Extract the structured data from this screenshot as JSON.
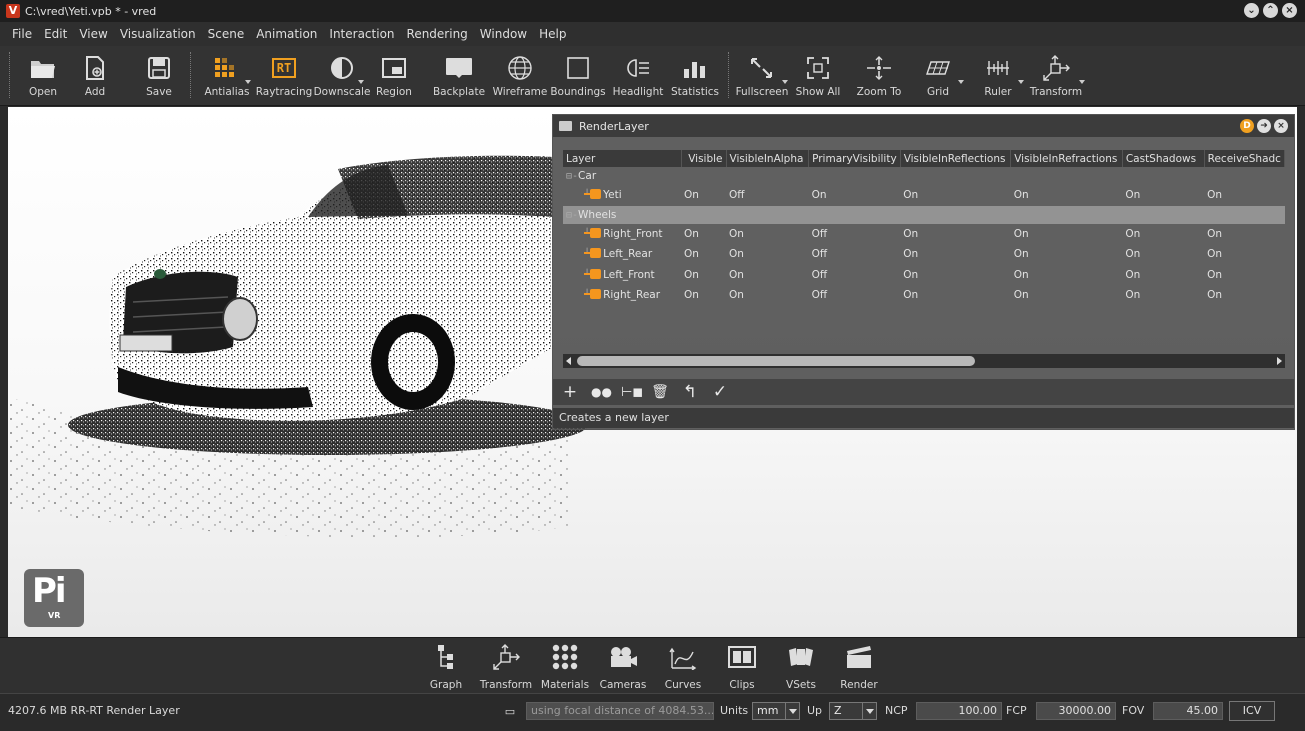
{
  "window": {
    "title": "C:\\vred\\Yeti.vpb * - vred",
    "app_logo": "V"
  },
  "menu": [
    "File",
    "Edit",
    "View",
    "Visualization",
    "Scene",
    "Animation",
    "Interaction",
    "Rendering",
    "Window",
    "Help"
  ],
  "toolbar": {
    "open": "Open",
    "add": "Add",
    "save": "Save",
    "antialias": "Antialias",
    "raytracing": "Raytracing",
    "raytracing_icon_text": "RT",
    "downscale": "Downscale",
    "region": "Region",
    "backplate": "Backplate",
    "wireframe": "Wireframe",
    "boundings": "Boundings",
    "headlight": "Headlight",
    "statistics": "Statistics",
    "fullscreen": "Fullscreen",
    "show_all": "Show All",
    "zoom_to": "Zoom To",
    "grid": "Grid",
    "ruler": "Ruler",
    "transform": "Transform"
  },
  "viewport": {
    "logo_text": "Pi",
    "logo_sub": "VR"
  },
  "render_layer": {
    "title": "RenderLayer",
    "columns": [
      "Layer",
      "Visible",
      "VisibleInAlpha",
      "PrimaryVisibility",
      "VisibleInReflections",
      "VisibleInRefractions",
      "CastShadows",
      "ReceiveShadc"
    ],
    "groups": [
      {
        "name": "Car",
        "rows": [
          {
            "name": "Yeti",
            "values": [
              "On",
              "Off",
              "On",
              "On",
              "On",
              "On",
              "On"
            ]
          }
        ]
      },
      {
        "name": "Wheels",
        "rows": [
          {
            "name": "Right_Front",
            "values": [
              "On",
              "On",
              "Off",
              "On",
              "On",
              "On",
              "On"
            ]
          },
          {
            "name": "Left_Rear",
            "values": [
              "On",
              "On",
              "Off",
              "On",
              "On",
              "On",
              "On"
            ]
          },
          {
            "name": "Left_Front",
            "values": [
              "On",
              "On",
              "Off",
              "On",
              "On",
              "On",
              "On"
            ]
          },
          {
            "name": "Right_Rear",
            "values": [
              "On",
              "On",
              "Off",
              "On",
              "On",
              "On",
              "On"
            ]
          }
        ]
      }
    ],
    "status": "Creates a new layer"
  },
  "dock": {
    "graph": "Graph",
    "transform": "Transform",
    "materials": "Materials",
    "cameras": "Cameras",
    "curves": "Curves",
    "clips": "Clips",
    "vsets": "VSets",
    "render": "Render"
  },
  "statusbar": {
    "memory": "4207.6 MB  RR-RT  Render Layer",
    "focal": "using focal distance of 4084.53...",
    "units_label": "Units",
    "units_value": "mm",
    "up_label": "Up",
    "up_value": "Z",
    "ncp_label": "NCP",
    "ncp_value": "100.00",
    "fcp_label": "FCP",
    "fcp_value": "30000.00",
    "fov_label": "FOV",
    "fov_value": "45.00",
    "icv": "ICV"
  }
}
